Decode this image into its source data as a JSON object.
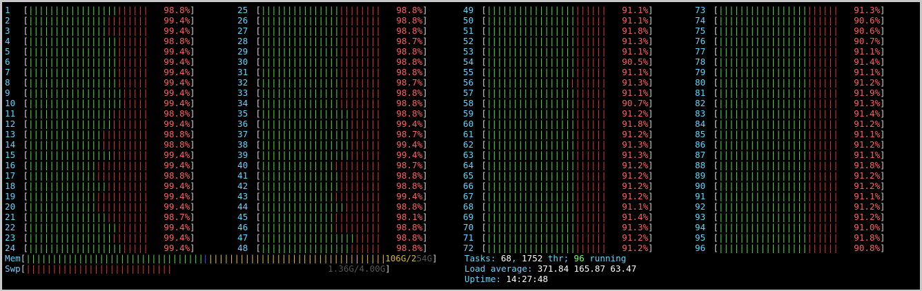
{
  "colors": {
    "cpu_label": "#5fd7ff",
    "bar_normal": "#4fd13f",
    "bar_kernel": "#d33434",
    "bar_cache": "#d8b432",
    "bar_buffers": "#3b4bff",
    "percent": "#ff5f5f",
    "background": "#000000"
  },
  "cpus": [
    {
      "id": "1",
      "pct": "98.8%",
      "green": 17,
      "red": 6
    },
    {
      "id": "2",
      "pct": "99.4%",
      "green": 15,
      "red": 8
    },
    {
      "id": "3",
      "pct": "99.4%",
      "green": 15,
      "red": 8
    },
    {
      "id": "4",
      "pct": "98.8%",
      "green": 17,
      "red": 6
    },
    {
      "id": "5",
      "pct": "99.4%",
      "green": 17,
      "red": 6
    },
    {
      "id": "6",
      "pct": "99.4%",
      "green": 17,
      "red": 6
    },
    {
      "id": "7",
      "pct": "99.4%",
      "green": 17,
      "red": 6
    },
    {
      "id": "8",
      "pct": "99.4%",
      "green": 17,
      "red": 6
    },
    {
      "id": "9",
      "pct": "99.4%",
      "green": 18,
      "red": 5
    },
    {
      "id": "10",
      "pct": "99.4%",
      "green": 18,
      "red": 5
    },
    {
      "id": "11",
      "pct": "98.8%",
      "green": 16,
      "red": 7
    },
    {
      "id": "12",
      "pct": "99.4%",
      "green": 16,
      "red": 7
    },
    {
      "id": "13",
      "pct": "98.8%",
      "green": 14,
      "red": 9
    },
    {
      "id": "14",
      "pct": "98.8%",
      "green": 14,
      "red": 9
    },
    {
      "id": "15",
      "pct": "99.4%",
      "green": 16,
      "red": 7
    },
    {
      "id": "16",
      "pct": "99.4%",
      "green": 13,
      "red": 10
    },
    {
      "id": "17",
      "pct": "98.8%",
      "green": 13,
      "red": 10
    },
    {
      "id": "18",
      "pct": "99.4%",
      "green": 15,
      "red": 8
    },
    {
      "id": "19",
      "pct": "99.4%",
      "green": 13,
      "red": 10
    },
    {
      "id": "20",
      "pct": "99.4%",
      "green": 13,
      "red": 10
    },
    {
      "id": "21",
      "pct": "98.7%",
      "green": 15,
      "red": 8
    },
    {
      "id": "22",
      "pct": "99.4%",
      "green": 17,
      "red": 6
    },
    {
      "id": "23",
      "pct": "99.4%",
      "green": 16,
      "red": 7
    },
    {
      "id": "24",
      "pct": "99.4%",
      "green": 18,
      "red": 5
    },
    {
      "id": "25",
      "pct": "98.8%",
      "green": 15,
      "red": 8
    },
    {
      "id": "26",
      "pct": "98.8%",
      "green": 15,
      "red": 8
    },
    {
      "id": "27",
      "pct": "98.8%",
      "green": 15,
      "red": 8
    },
    {
      "id": "28",
      "pct": "98.7%",
      "green": 15,
      "red": 8
    },
    {
      "id": "29",
      "pct": "98.8%",
      "green": 15,
      "red": 8
    },
    {
      "id": "30",
      "pct": "98.8%",
      "green": 15,
      "red": 8
    },
    {
      "id": "31",
      "pct": "98.8%",
      "green": 15,
      "red": 8
    },
    {
      "id": "32",
      "pct": "98.7%",
      "green": 15,
      "red": 8
    },
    {
      "id": "33",
      "pct": "98.8%",
      "green": 15,
      "red": 8
    },
    {
      "id": "34",
      "pct": "98.8%",
      "green": 15,
      "red": 8
    },
    {
      "id": "35",
      "pct": "98.8%",
      "green": 17,
      "red": 6
    },
    {
      "id": "36",
      "pct": "99.4%",
      "green": 17,
      "red": 6
    },
    {
      "id": "37",
      "pct": "98.7%",
      "green": 17,
      "red": 6
    },
    {
      "id": "38",
      "pct": "99.4%",
      "green": 17,
      "red": 6
    },
    {
      "id": "39",
      "pct": "99.4%",
      "green": 17,
      "red": 6
    },
    {
      "id": "40",
      "pct": "98.7%",
      "green": 14,
      "red": 9
    },
    {
      "id": "41",
      "pct": "98.8%",
      "green": 15,
      "red": 8
    },
    {
      "id": "42",
      "pct": "98.8%",
      "green": 15,
      "red": 8
    },
    {
      "id": "43",
      "pct": "99.4%",
      "green": 14,
      "red": 9
    },
    {
      "id": "44",
      "pct": "98.8%",
      "green": 16,
      "red": 7
    },
    {
      "id": "45",
      "pct": "98.1%",
      "green": 14,
      "red": 9
    },
    {
      "id": "46",
      "pct": "98.8%",
      "green": 14,
      "red": 9
    },
    {
      "id": "47",
      "pct": "98.8%",
      "green": 18,
      "red": 5
    },
    {
      "id": "48",
      "pct": "98.8%",
      "green": 17,
      "red": 6
    },
    {
      "id": "49",
      "pct": "91.1%",
      "green": 17,
      "red": 6
    },
    {
      "id": "50",
      "pct": "91.1%",
      "green": 17,
      "red": 6
    },
    {
      "id": "51",
      "pct": "91.8%",
      "green": 17,
      "red": 6
    },
    {
      "id": "52",
      "pct": "91.3%",
      "green": 17,
      "red": 6
    },
    {
      "id": "53",
      "pct": "91.1%",
      "green": 17,
      "red": 6
    },
    {
      "id": "54",
      "pct": "90.5%",
      "green": 17,
      "red": 6
    },
    {
      "id": "55",
      "pct": "91.1%",
      "green": 17,
      "red": 6
    },
    {
      "id": "56",
      "pct": "91.3%",
      "green": 16,
      "red": 7
    },
    {
      "id": "57",
      "pct": "91.1%",
      "green": 17,
      "red": 6
    },
    {
      "id": "58",
      "pct": "90.7%",
      "green": 17,
      "red": 6
    },
    {
      "id": "59",
      "pct": "91.2%",
      "green": 17,
      "red": 6
    },
    {
      "id": "60",
      "pct": "91.8%",
      "green": 17,
      "red": 6
    },
    {
      "id": "61",
      "pct": "91.2%",
      "green": 17,
      "red": 6
    },
    {
      "id": "62",
      "pct": "91.3%",
      "green": 17,
      "red": 6
    },
    {
      "id": "63",
      "pct": "91.3%",
      "green": 17,
      "red": 6
    },
    {
      "id": "64",
      "pct": "91.2%",
      "green": 17,
      "red": 6
    },
    {
      "id": "65",
      "pct": "91.2%",
      "green": 17,
      "red": 6
    },
    {
      "id": "66",
      "pct": "91.2%",
      "green": 17,
      "red": 6
    },
    {
      "id": "67",
      "pct": "91.2%",
      "green": 17,
      "red": 6
    },
    {
      "id": "68",
      "pct": "91.1%",
      "green": 17,
      "red": 6
    },
    {
      "id": "69",
      "pct": "91.4%",
      "green": 17,
      "red": 6
    },
    {
      "id": "70",
      "pct": "91.3%",
      "green": 17,
      "red": 6
    },
    {
      "id": "71",
      "pct": "91.2%",
      "green": 17,
      "red": 6
    },
    {
      "id": "72",
      "pct": "91.2%",
      "green": 17,
      "red": 6
    },
    {
      "id": "73",
      "pct": "91.3%",
      "green": 17,
      "red": 6
    },
    {
      "id": "74",
      "pct": "90.6%",
      "green": 17,
      "red": 6
    },
    {
      "id": "75",
      "pct": "90.6%",
      "green": 17,
      "red": 6
    },
    {
      "id": "76",
      "pct": "90.7%",
      "green": 17,
      "red": 6
    },
    {
      "id": "77",
      "pct": "91.1%",
      "green": 17,
      "red": 6
    },
    {
      "id": "78",
      "pct": "91.4%",
      "green": 17,
      "red": 6
    },
    {
      "id": "79",
      "pct": "91.1%",
      "green": 17,
      "red": 6
    },
    {
      "id": "80",
      "pct": "91.2%",
      "green": 17,
      "red": 6
    },
    {
      "id": "81",
      "pct": "91.9%",
      "green": 17,
      "red": 6
    },
    {
      "id": "82",
      "pct": "91.3%",
      "green": 17,
      "red": 6
    },
    {
      "id": "83",
      "pct": "91.4%",
      "green": 17,
      "red": 6
    },
    {
      "id": "84",
      "pct": "91.2%",
      "green": 17,
      "red": 6
    },
    {
      "id": "85",
      "pct": "91.1%",
      "green": 17,
      "red": 6
    },
    {
      "id": "86",
      "pct": "91.2%",
      "green": 17,
      "red": 6
    },
    {
      "id": "87",
      "pct": "91.1%",
      "green": 17,
      "red": 6
    },
    {
      "id": "88",
      "pct": "91.8%",
      "green": 17,
      "red": 6
    },
    {
      "id": "89",
      "pct": "91.2%",
      "green": 17,
      "red": 6
    },
    {
      "id": "90",
      "pct": "91.2%",
      "green": 17,
      "red": 6
    },
    {
      "id": "91",
      "pct": "91.1%",
      "green": 17,
      "red": 6
    },
    {
      "id": "92",
      "pct": "91.2%",
      "green": 17,
      "red": 6
    },
    {
      "id": "93",
      "pct": "91.2%",
      "green": 17,
      "red": 6
    },
    {
      "id": "94",
      "pct": "91.0%",
      "green": 17,
      "red": 6
    },
    {
      "id": "95",
      "pct": "91.8%",
      "green": 17,
      "red": 6
    },
    {
      "id": "96",
      "pct": "90.8%",
      "green": 17,
      "red": 6
    }
  ],
  "mem": {
    "label": "Mem",
    "used_text": "106G",
    "total_text": "/2",
    "total_dim": "54G",
    "green": 34,
    "blue": 1,
    "yellow": 34
  },
  "swp": {
    "label": "Swp",
    "used_text": "1.36G",
    "total_text": "/4.00G",
    "red": 28
  },
  "tasks": {
    "label": "Tasks: ",
    "count": "68",
    "sep": ", ",
    "thr": "1752",
    "thr_label": " thr; ",
    "running": "96",
    "running_label": " running"
  },
  "load": {
    "label": "Load average: ",
    "one": "371.84",
    "five": "165.87",
    "fifteen": "63.47"
  },
  "uptime": {
    "label": "Uptime: ",
    "value": "14:27:48"
  }
}
